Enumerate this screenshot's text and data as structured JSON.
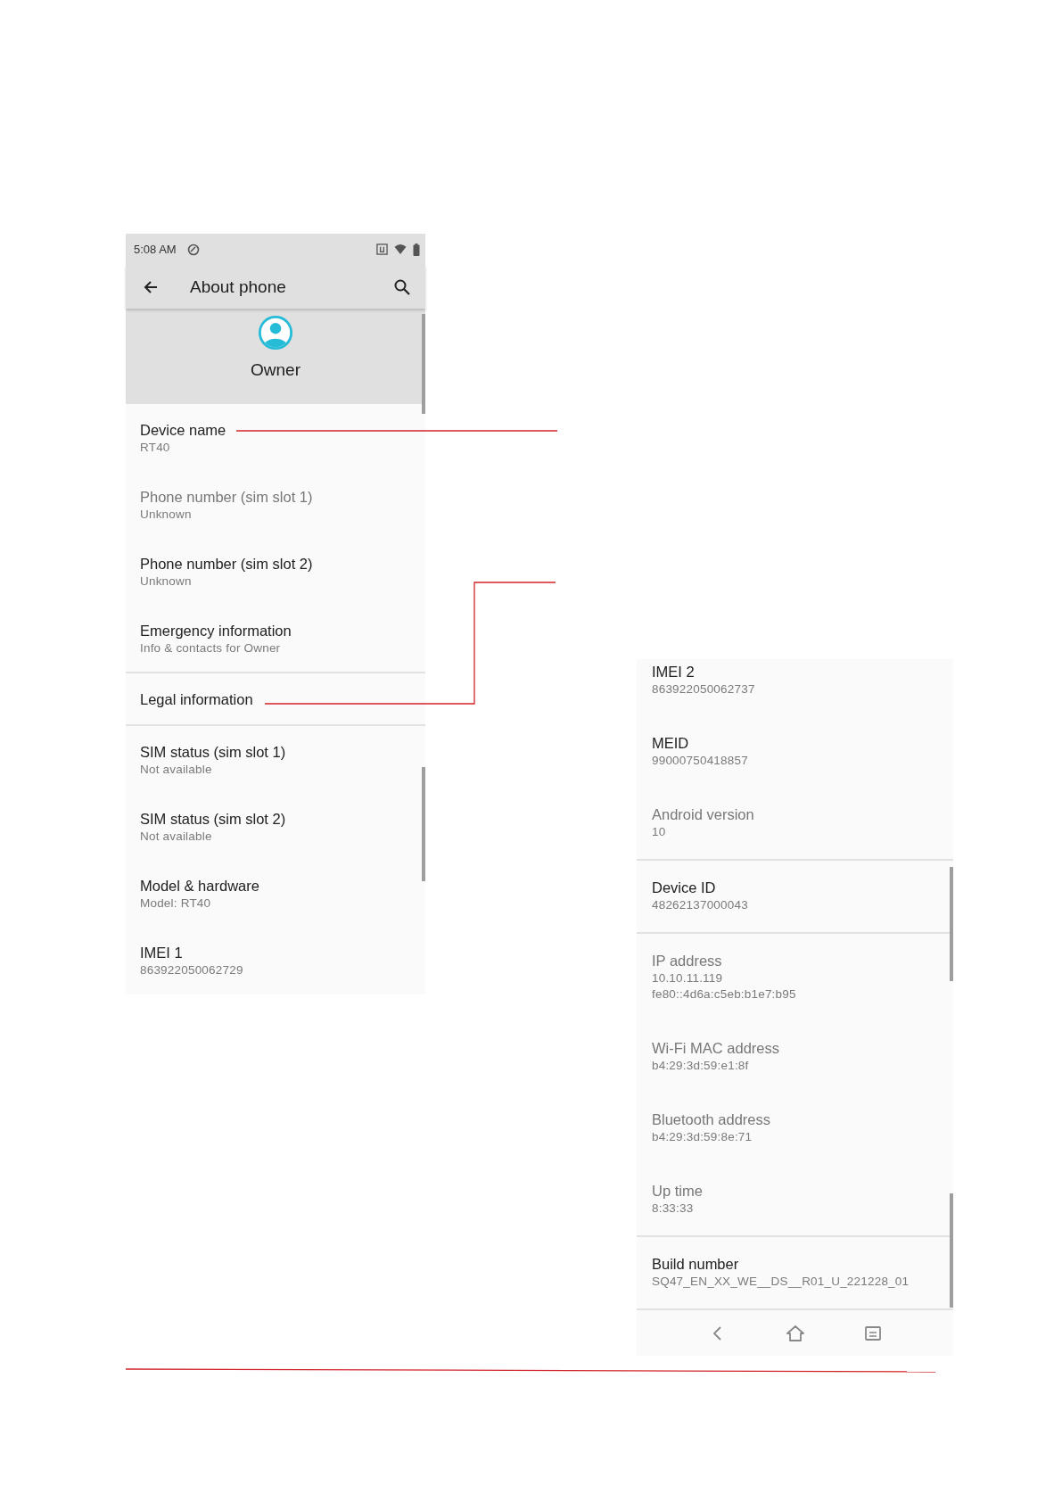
{
  "screens": [
    {
      "kind": "top",
      "status_bar": {
        "time": "5:08 AM"
      },
      "app_bar": {
        "title": "About phone"
      },
      "profile": {
        "name": "Owner"
      },
      "groups": [
        [
          {
            "title": "Device name",
            "summary": "RT40",
            "disabled": false
          },
          {
            "title": "Phone number (sim slot 1)",
            "summary": "Unknown",
            "disabled": true
          },
          {
            "title": "Phone number (sim slot 2)",
            "summary": "Unknown",
            "disabled": false
          },
          {
            "title": "Emergency information",
            "summary": "Info & contacts for Owner",
            "disabled": false
          }
        ],
        [
          {
            "title": "Legal information",
            "disabled": false
          }
        ],
        [
          {
            "title": "SIM status (sim slot 1)",
            "summary": "Not available",
            "disabled": false
          },
          {
            "title": "SIM status (sim slot 2)",
            "summary": "Not available",
            "disabled": false
          },
          {
            "title": "Model & hardware",
            "summary": "Model: RT40",
            "disabled": false
          },
          {
            "title": "IMEI 1",
            "summary": "863922050062729",
            "disabled": false
          }
        ]
      ]
    },
    {
      "kind": "bottom",
      "groups": [
        [
          {
            "title": "IMEI 2",
            "summary": "863922050062737",
            "disabled": false
          },
          {
            "title": "MEID",
            "summary": "99000750418857",
            "disabled": false
          },
          {
            "title": "Android version",
            "summary": "10",
            "disabled": true
          }
        ],
        [
          {
            "title": "Device ID",
            "summary": "48262137000043",
            "disabled": false
          }
        ],
        [
          {
            "title": "IP address",
            "summary": "10.10.11.119\nfe80::4d6a:c5eb:b1e7:b95",
            "disabled": true
          },
          {
            "title": "Wi-Fi MAC address",
            "summary": "b4:29:3d:59:e1:8f",
            "disabled": true
          },
          {
            "title": "Bluetooth address",
            "summary": "b4:29:3d:59:8e:71",
            "disabled": true
          },
          {
            "title": "Up time",
            "summary": "8:33:33",
            "disabled": true
          }
        ],
        [
          {
            "title": "Build number",
            "summary": "SQ47_EN_XX_WE__DS__R01_U_221228_01",
            "disabled": false
          }
        ]
      ]
    }
  ]
}
